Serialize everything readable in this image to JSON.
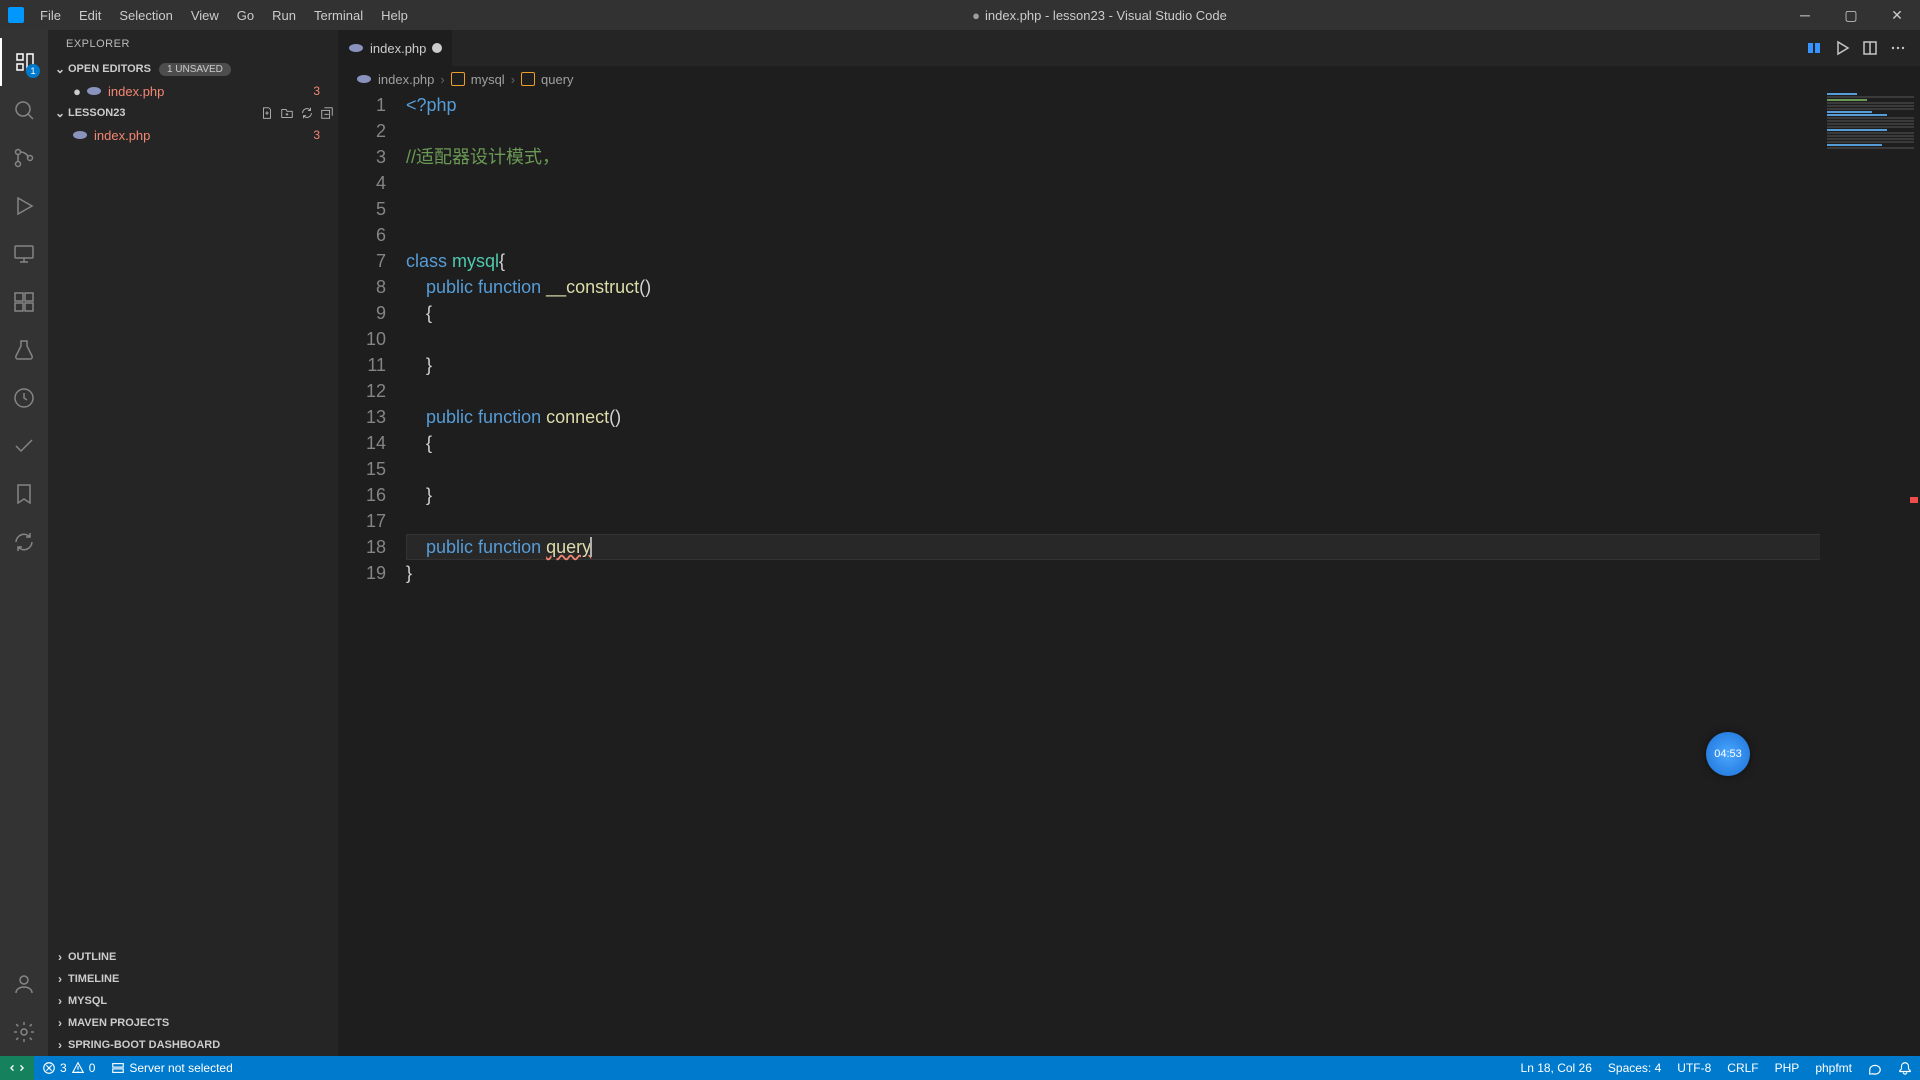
{
  "titlebar": {
    "menu": [
      "File",
      "Edit",
      "Selection",
      "View",
      "Go",
      "Run",
      "Terminal",
      "Help"
    ],
    "title_prefix": "●",
    "title": "index.php - lesson23 - Visual Studio Code"
  },
  "activity": {
    "explorer_badge": "1"
  },
  "sidebar": {
    "title": "EXPLORER",
    "open_editors": {
      "label": "OPEN EDITORS",
      "unsaved": "1 UNSAVED"
    },
    "open_editors_items": [
      {
        "name": "index.php",
        "errors": "3"
      }
    ],
    "workspace": {
      "label": "LESSON23"
    },
    "workspace_items": [
      {
        "name": "index.php",
        "errors": "3"
      }
    ],
    "sections": [
      "OUTLINE",
      "TIMELINE",
      "MYSQL",
      "MAVEN PROJECTS",
      "SPRING-BOOT DASHBOARD"
    ]
  },
  "tabs": {
    "active": {
      "name": "index.php"
    }
  },
  "breadcrumbs": {
    "file": "index.php",
    "class": "mysql",
    "method": "query"
  },
  "code": {
    "lines": [
      {
        "n": "1",
        "tokens": [
          [
            "<?php",
            "k-declare"
          ]
        ]
      },
      {
        "n": "2",
        "tokens": []
      },
      {
        "n": "3",
        "tokens": [
          [
            "//适配器设计模式，",
            "k-comment"
          ]
        ]
      },
      {
        "n": "4",
        "tokens": []
      },
      {
        "n": "5",
        "tokens": []
      },
      {
        "n": "6",
        "tokens": []
      },
      {
        "n": "7",
        "tokens": [
          [
            "class ",
            "k-declare"
          ],
          [
            "mysql",
            "k-type"
          ],
          [
            "{",
            "k-punct"
          ]
        ]
      },
      {
        "n": "8",
        "indent": "    ",
        "tokens": [
          [
            "public ",
            "k-declare"
          ],
          [
            "function ",
            "k-declare"
          ],
          [
            "__construct",
            "k-func"
          ],
          [
            "()",
            "k-punct"
          ]
        ]
      },
      {
        "n": "9",
        "indent": "    ",
        "tokens": [
          [
            "{",
            "k-punct"
          ]
        ]
      },
      {
        "n": "10",
        "indent": "        ",
        "tokens": []
      },
      {
        "n": "11",
        "indent": "    ",
        "tokens": [
          [
            "}",
            "k-punct"
          ]
        ]
      },
      {
        "n": "12",
        "tokens": []
      },
      {
        "n": "13",
        "indent": "    ",
        "tokens": [
          [
            "public ",
            "k-declare"
          ],
          [
            "function ",
            "k-declare"
          ],
          [
            "connect",
            "k-func"
          ],
          [
            "()",
            "k-punct"
          ]
        ]
      },
      {
        "n": "14",
        "indent": "    ",
        "tokens": [
          [
            "{",
            "k-punct"
          ]
        ]
      },
      {
        "n": "15",
        "indent": "        ",
        "tokens": []
      },
      {
        "n": "16",
        "indent": "    ",
        "tokens": [
          [
            "}",
            "k-punct"
          ]
        ]
      },
      {
        "n": "17",
        "tokens": []
      },
      {
        "n": "18",
        "indent": "    ",
        "tokens": [
          [
            "public ",
            "k-declare"
          ],
          [
            "function ",
            "k-declare"
          ],
          [
            "query",
            "k-func wavy"
          ]
        ],
        "current": true,
        "cursor": true
      },
      {
        "n": "19",
        "tokens": [
          [
            "}",
            "k-punct"
          ]
        ]
      }
    ]
  },
  "timer": {
    "value": "04:53"
  },
  "status": {
    "errors": "3",
    "warnings": "0",
    "server": "Server not selected",
    "position": "Ln 18, Col 26",
    "spaces": "Spaces: 4",
    "encoding": "UTF-8",
    "eol": "CRLF",
    "lang": "PHP",
    "formatter": "phpfmt"
  }
}
